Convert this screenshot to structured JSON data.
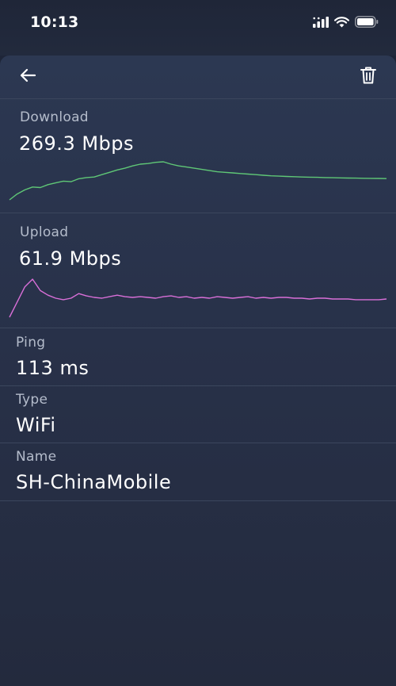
{
  "status_bar": {
    "time": "10:13",
    "icons": [
      "cellular-signal-icon",
      "wifi-icon",
      "battery-icon"
    ]
  },
  "nav": {
    "back_icon": "arrow-left-icon",
    "delete_icon": "trash-icon"
  },
  "download": {
    "label": "Download",
    "value": "269.3 Mbps",
    "color": "#5fc776",
    "samples": [
      0,
      10,
      17,
      22,
      21,
      26,
      29,
      32,
      31,
      36,
      38,
      39,
      43,
      47,
      51,
      54,
      58,
      61,
      62,
      64,
      65,
      61,
      58,
      56,
      54,
      52,
      50,
      48,
      47,
      46,
      45,
      44,
      43,
      42,
      41,
      40.5,
      40,
      39.5,
      39,
      38.7,
      38.4,
      38.1,
      37.8,
      37.5,
      37.3,
      37.1,
      36.9,
      36.7,
      36.5,
      36.3
    ]
  },
  "upload": {
    "label": "Upload",
    "value": "61.9 Mbps",
    "color": "#d96fd8",
    "samples": [
      5,
      25,
      45,
      55,
      40,
      34,
      30,
      28,
      30,
      36,
      33,
      31,
      30,
      32,
      34,
      32,
      31,
      32,
      31,
      30,
      32,
      33,
      31,
      32,
      30,
      31,
      30,
      32,
      31,
      30,
      31,
      32,
      30,
      31,
      30,
      31,
      31,
      30,
      30,
      29,
      30,
      30,
      29,
      29,
      29,
      28,
      28,
      28,
      28,
      29
    ]
  },
  "ping": {
    "label": "Ping",
    "value": "113 ms"
  },
  "type": {
    "label": "Type",
    "value": "WiFi"
  },
  "name": {
    "label": "Name",
    "value": "SH-ChinaMobile"
  }
}
